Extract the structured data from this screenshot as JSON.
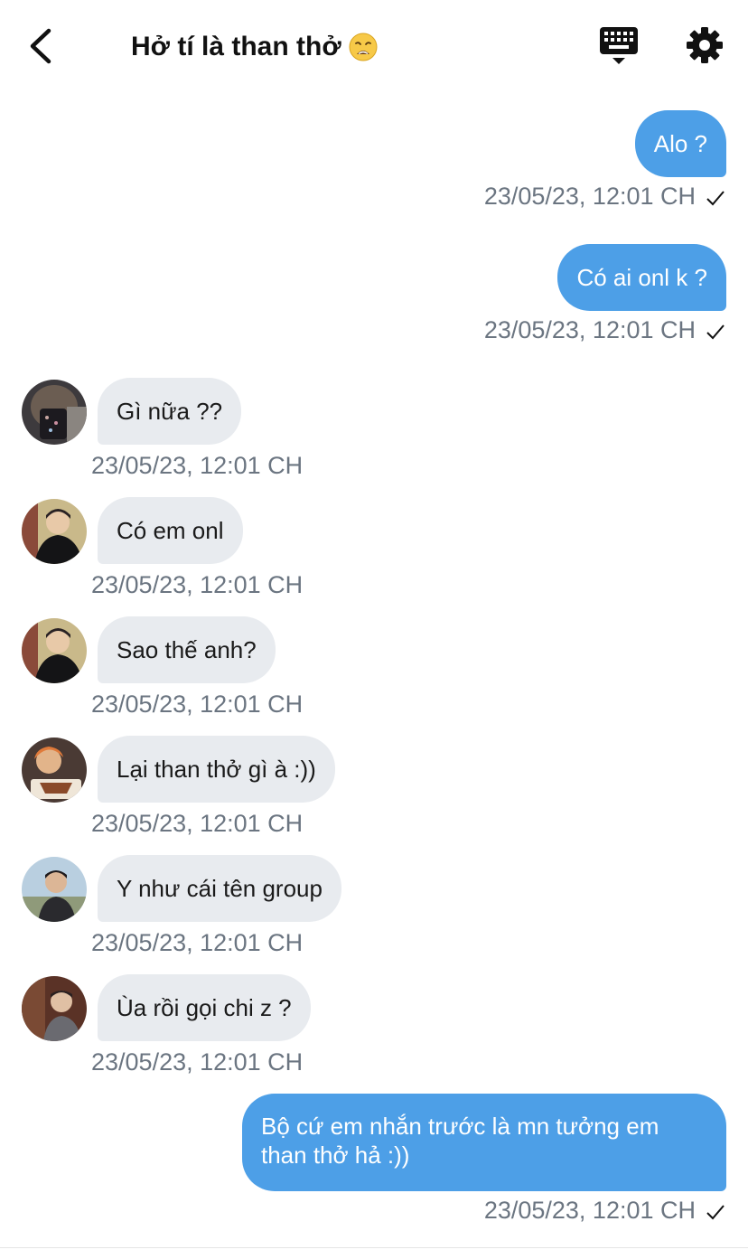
{
  "header": {
    "title": "Hở tí là than thở",
    "emoji": "weary-face-emoji"
  },
  "icons": {
    "back": "chevron-left-icon",
    "keyboard": "keyboard-icon",
    "settings": "gear-icon"
  },
  "colors": {
    "outgoing_bubble": "#4d9fe7",
    "incoming_bubble": "#e8ebef",
    "timestamp": "#6b7581"
  },
  "messages": [
    {
      "direction": "out",
      "text": "Alo ?",
      "time": "23/05/23, 12:01 CH",
      "read": true
    },
    {
      "direction": "out",
      "text": "Có ai onl k ?",
      "time": "23/05/23, 12:01 CH",
      "read": true
    },
    {
      "direction": "in",
      "text": "Gì nữa ??",
      "time": "23/05/23, 12:01 CH",
      "avatar": "avatar-1"
    },
    {
      "direction": "in",
      "text": "Có em onl",
      "time": "23/05/23, 12:01 CH",
      "avatar": "avatar-2"
    },
    {
      "direction": "in",
      "text": "Sao thế anh?",
      "time": "23/05/23, 12:01 CH",
      "avatar": "avatar-2"
    },
    {
      "direction": "in",
      "text": "Lại than thở gì à :))",
      "time": "23/05/23, 12:01 CH",
      "avatar": "avatar-3"
    },
    {
      "direction": "in",
      "text": "Y như cái tên group",
      "time": "23/05/23, 12:01 CH",
      "avatar": "avatar-4"
    },
    {
      "direction": "in",
      "text": "Ùa rồi gọi chi z ?",
      "time": "23/05/23, 12:01 CH",
      "avatar": "avatar-5"
    },
    {
      "direction": "out",
      "text": "Bộ cứ em nhắn trước là mn tưởng em than thở hả :))",
      "time": "23/05/23, 12:01 CH",
      "read": true
    }
  ]
}
